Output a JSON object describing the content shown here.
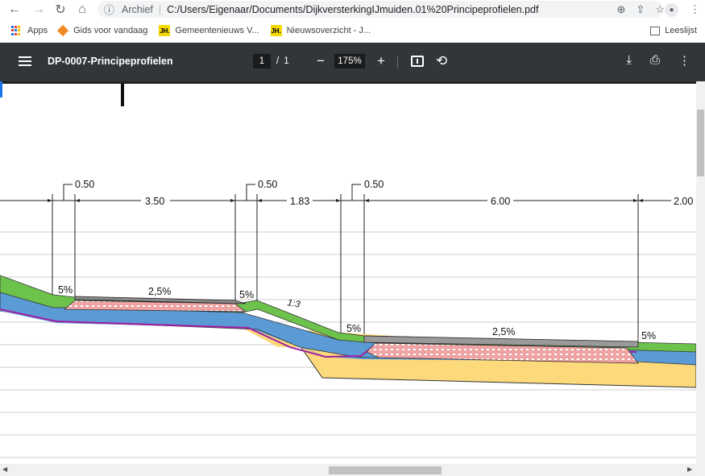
{
  "browser": {
    "url_prefix": "Archief",
    "url": "C:/Users/Eigenaar/Documents/DijkversterkingIJmuiden.01%20Principeprofielen.pdf",
    "bookmarks": [
      {
        "label": "Apps"
      },
      {
        "label": "Gids voor vandaag"
      },
      {
        "label": "Gemeentenieuws V..."
      },
      {
        "label": "Nieuwsoverzicht - J..."
      }
    ],
    "reading_list": "Leeslijst",
    "jh_badge": "JH."
  },
  "pdf": {
    "title": "DP-0007-Principeprofielen",
    "page_current": "1",
    "page_sep": "/",
    "page_total": "1",
    "zoom": "175%"
  },
  "drawing": {
    "dims": {
      "d1": "0.50",
      "d2": "3.50",
      "d3": "0.50",
      "d4": "1.83",
      "d5": "0.50",
      "d6": "6.00",
      "d7": "2.00"
    },
    "slopes": {
      "s1": "5%",
      "s2": "2,5%",
      "s3": "5%",
      "s4": "1:3",
      "s5": "5%",
      "s6": "2,5%",
      "s7": "5%"
    }
  },
  "colors": {
    "toolbar": "#323639",
    "green": "#6cc24a",
    "blue": "#5b9bd5",
    "sand": "#fcd97b",
    "pink": "#f4a6a6",
    "purple": "#a020a0"
  }
}
